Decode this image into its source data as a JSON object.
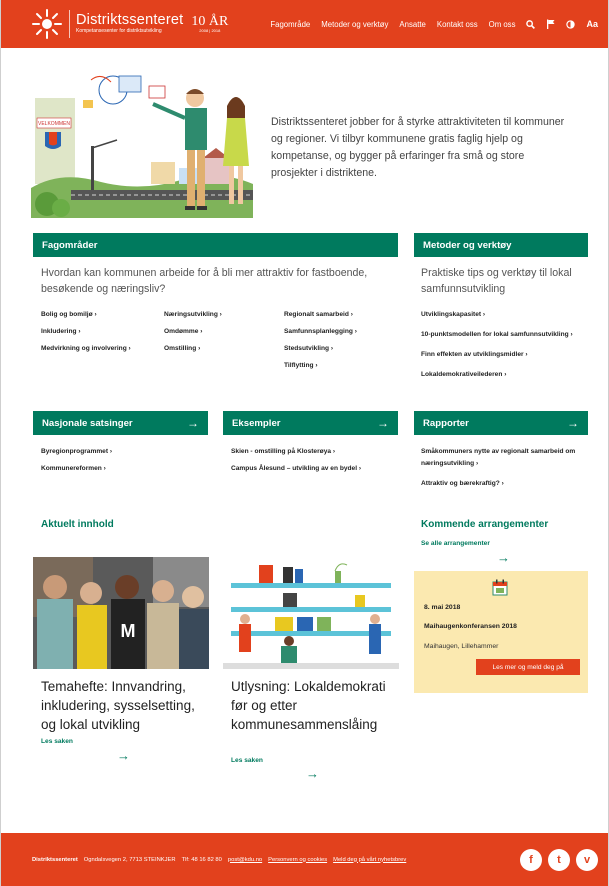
{
  "header": {
    "logo_title": "Distriktssenteret",
    "logo_subtitle": "Kompetansesenter for distriktsutvikling",
    "anniversary": "10 ÅR",
    "anniversary_years": "2008 | 2018",
    "nav": [
      "Fagområde",
      "Metoder og verktøy",
      "Ansatte",
      "Kontakt oss",
      "Om oss"
    ],
    "icons": [
      "search-icon",
      "flag-icon",
      "contrast-icon",
      "font-size-icon"
    ],
    "font_size_label": "Aa",
    "accent": "#e2411d"
  },
  "hero": {
    "text": "Distriktssenteret jobber for å styrke attraktiviteten til kommuner og regioner. Vi tilbyr kommunene gratis faglig hjelp og kompetanse, og bygger på erfaringer fra små og store prosjekter i distriktene.",
    "sign_text": "VELKOMMEN"
  },
  "fagomrader": {
    "title": "Fagområder",
    "lead": "Hvordan kan kommunen arbeide for å bli mer attraktiv for fastboende, besøkende og næringsliv?",
    "col1": [
      "Bolig og bomiljø ›",
      "Inkludering ›",
      "Medvirkning og involvering ›"
    ],
    "col2": [
      "Næringsutvikling ›",
      "Omdømme ›",
      "Omstilling ›"
    ],
    "col3": [
      "Regionalt samarbeid ›",
      "Samfunnsplanlegging ›",
      "Stedsutvikling ›",
      "Tilflytting ›"
    ]
  },
  "metoder": {
    "title": "Metoder og verktøy",
    "lead": "Praktiske tips og verktøy til lokal samfunnsutvikling",
    "links": [
      "Utviklingskapasitet ›",
      "10-punktsmodellen for lokal samfunnsutvikling ›",
      "Finn effekten av utviklingsmidler ›",
      "Lokaldemokrativeilederen ›"
    ]
  },
  "nasjonale": {
    "title": "Nasjonale satsinger",
    "arrow": "→",
    "links": [
      "Byregionprogrammet ›",
      "Kommunereformen ›"
    ]
  },
  "eksempler": {
    "title": "Eksempler",
    "arrow": "→",
    "links": [
      "Skien - omstilling på Klosterøya ›",
      "Campus Ålesund – utvikling av en bydel ›"
    ]
  },
  "rapporter": {
    "title": "Rapporter",
    "arrow": "→",
    "links": [
      "Småkommuners nytte av regionalt samarbeid om næringsutvikling ›",
      "Attraktiv og bærekraftig? ›"
    ]
  },
  "aktuelt": {
    "title": "Aktuelt innhold",
    "articles": [
      {
        "title": "Temahefte: Innvandring, inkludering, sysselsetting, og lokal utvikling",
        "more": "Les saken",
        "arrow": "→"
      },
      {
        "title": "Utlysning: Lokaldemokrati før og etter kommunesammenslåing",
        "more": "Les saken",
        "arrow": "→"
      }
    ]
  },
  "arrangementer": {
    "title": "Kommende arrangementer",
    "see_all": "Se alle arrangementer",
    "arrow": "→",
    "event": {
      "date": "8. mai 2018",
      "name": "Maihaugenkonferansen 2018",
      "place": "Maihaugen, Lillehammer",
      "button": "Les mer og meld deg på"
    }
  },
  "footer": {
    "name": "Distriktssenteret",
    "address": "Ogndalsvegen 2, 7713 STEINKJER",
    "phone": "Tlf: 48 16 82 80",
    "email": "post@kdu.no",
    "privacy": "Personvern og cookies",
    "newsletter": "Meld deg på vårt nyhetsbrev",
    "social": [
      "facebook-icon",
      "twitter-icon",
      "vimeo-icon"
    ],
    "social_letters": [
      "f",
      "t",
      "v"
    ]
  }
}
